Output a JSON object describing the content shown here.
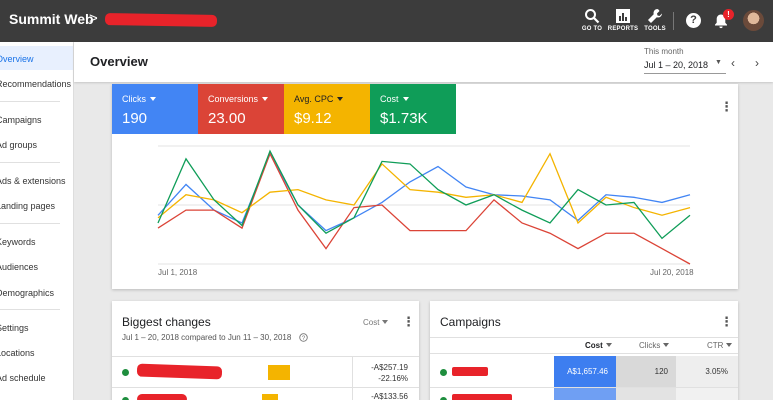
{
  "app": {
    "title": "Summit Web",
    "separator": ">"
  },
  "toolbar": {
    "goto_label": "GO TO",
    "reports_label": "REPORTS",
    "tools_label": "TOOLS",
    "help_label": "?",
    "notification_count": "!"
  },
  "sidebar": {
    "items": [
      {
        "label": "Overview"
      },
      {
        "label": "Recommendations"
      },
      {
        "label": "Campaigns"
      },
      {
        "label": "Ad groups"
      },
      {
        "label": "Ads & extensions"
      },
      {
        "label": "Landing pages"
      },
      {
        "label": "Keywords"
      },
      {
        "label": "Audiences"
      },
      {
        "label": "Demographics"
      },
      {
        "label": "Settings"
      },
      {
        "label": "Locations"
      },
      {
        "label": "Ad schedule"
      }
    ]
  },
  "header": {
    "title": "Overview",
    "date_label": "This month",
    "date_range": "Jul 1 – 20, 2018",
    "prev": "‹",
    "next": "›"
  },
  "overview_card": {
    "tiles": [
      {
        "label": "Clicks",
        "value": "190",
        "color": "#4285f4"
      },
      {
        "label": "Conversions",
        "value": "23.00",
        "color": "#db4437"
      },
      {
        "label": "Avg. CPC",
        "value": "$9.12",
        "color": "#f4b400"
      },
      {
        "label": "Cost",
        "value": "$1.73K",
        "color": "#0f9d58"
      }
    ],
    "menu": "⋮"
  },
  "chart_data": {
    "type": "line",
    "x_labels": [
      "Jul 1, 2018",
      "Jul 20, 2018"
    ],
    "x": [
      1,
      2,
      3,
      4,
      5,
      6,
      7,
      8,
      9,
      10,
      11,
      12,
      13,
      14,
      15,
      16,
      17,
      18,
      19,
      20
    ],
    "series": [
      {
        "color": "#4285f4",
        "values": [
          190,
          310,
          210,
          160,
          430,
          230,
          130,
          180,
          240,
          320,
          380,
          300,
          270,
          265,
          250,
          170,
          270,
          260,
          240,
          270
        ]
      },
      {
        "color": "#db4437",
        "values": [
          140,
          210,
          210,
          140,
          430,
          210,
          60,
          220,
          230,
          130,
          130,
          130,
          250,
          160,
          120,
          60,
          120,
          120,
          60,
          0
        ]
      },
      {
        "color": "#f4b400",
        "values": [
          180,
          270,
          250,
          200,
          280,
          290,
          250,
          230,
          390,
          290,
          280,
          260,
          270,
          240,
          430,
          160,
          260,
          220,
          190,
          220
        ]
      },
      {
        "color": "#0f9d58",
        "values": [
          160,
          410,
          250,
          150,
          440,
          230,
          120,
          180,
          400,
          390,
          290,
          230,
          270,
          210,
          160,
          290,
          230,
          240,
          100,
          190
        ]
      }
    ],
    "ylim": [
      0,
      460
    ]
  },
  "changes_card": {
    "title": "Biggest changes",
    "filter": "Cost",
    "subtitle": "Jul 1 – 20, 2018 compared to Jun 11 – 30, 2018",
    "rows": [
      {
        "value": "-A$257.19",
        "change": "-22.16%"
      },
      {
        "value": "-A$133.56",
        "change": ""
      }
    ]
  },
  "campaigns_card": {
    "title": "Campaigns",
    "columns": [
      "Cost",
      "Clicks",
      "CTR"
    ],
    "rows": [
      {
        "cost": "A$1,657.46",
        "clicks": "120",
        "ctr": "3.05%"
      }
    ]
  }
}
